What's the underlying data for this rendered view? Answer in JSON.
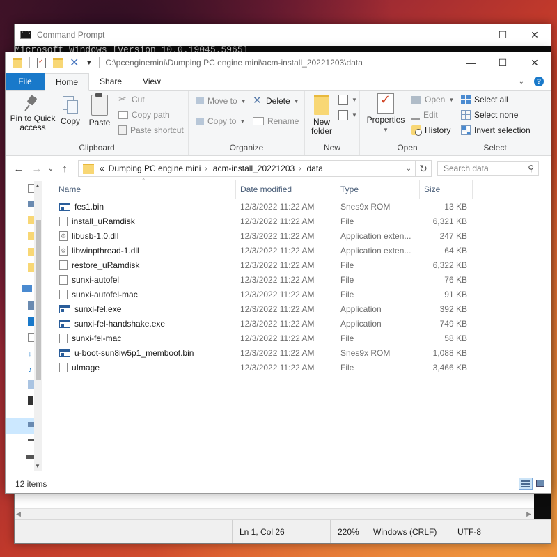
{
  "cmd": {
    "title": "Command Prompt",
    "body_text": "Microsoft Windows [Version 10.0.19045.5965]"
  },
  "notepad_status": {
    "position": "Ln 1, Col 26",
    "zoom": "220%",
    "line_ending": "Windows (CRLF)",
    "encoding": "UTF-8"
  },
  "explorer": {
    "title_path": "C:\\pcenginemini\\Dumping PC engine mini\\acm-install_20221203\\data",
    "window_controls": {
      "minimize": "—",
      "maximize": "☐",
      "close": "✕"
    },
    "tabs": {
      "file": "File",
      "home": "Home",
      "share": "Share",
      "view": "View"
    },
    "ribbon": {
      "clipboard": {
        "label": "Clipboard",
        "pin": "Pin to Quick access",
        "copy": "Copy",
        "paste": "Paste",
        "cut": "Cut",
        "copy_path": "Copy path",
        "paste_shortcut": "Paste shortcut"
      },
      "organize": {
        "label": "Organize",
        "move_to": "Move to",
        "copy_to": "Copy to",
        "delete": "Delete",
        "rename": "Rename"
      },
      "new": {
        "label": "New",
        "new_folder": "New folder"
      },
      "open": {
        "label": "Open",
        "properties": "Properties",
        "open": "Open",
        "edit": "Edit",
        "history": "History"
      },
      "select": {
        "label": "Select",
        "select_all": "Select all",
        "select_none": "Select none",
        "invert": "Invert selection"
      }
    },
    "address": {
      "prefix": "«",
      "crumbs": [
        "Dumping PC engine mini",
        "acm-install_20221203",
        "data"
      ]
    },
    "search": {
      "placeholder": "Search data"
    },
    "columns": {
      "name": "Name",
      "date": "Date modified",
      "type": "Type",
      "size": "Size"
    },
    "files": [
      {
        "name": "fes1.bin",
        "date": "12/3/2022 11:22 AM",
        "type": "Snes9x ROM",
        "size": "13 KB",
        "icon": "rom"
      },
      {
        "name": "install_uRamdisk",
        "date": "12/3/2022 11:22 AM",
        "type": "File",
        "size": "6,321 KB",
        "icon": "file"
      },
      {
        "name": "libusb-1.0.dll",
        "date": "12/3/2022 11:22 AM",
        "type": "Application exten...",
        "size": "247 KB",
        "icon": "dll"
      },
      {
        "name": "libwinpthread-1.dll",
        "date": "12/3/2022 11:22 AM",
        "type": "Application exten...",
        "size": "64 KB",
        "icon": "dll"
      },
      {
        "name": "restore_uRamdisk",
        "date": "12/3/2022 11:22 AM",
        "type": "File",
        "size": "6,322 KB",
        "icon": "file"
      },
      {
        "name": "sunxi-autofel",
        "date": "12/3/2022 11:22 AM",
        "type": "File",
        "size": "76 KB",
        "icon": "file"
      },
      {
        "name": "sunxi-autofel-mac",
        "date": "12/3/2022 11:22 AM",
        "type": "File",
        "size": "91 KB",
        "icon": "file"
      },
      {
        "name": "sunxi-fel.exe",
        "date": "12/3/2022 11:22 AM",
        "type": "Application",
        "size": "392 KB",
        "icon": "exe"
      },
      {
        "name": "sunxi-fel-handshake.exe",
        "date": "12/3/2022 11:22 AM",
        "type": "Application",
        "size": "749 KB",
        "icon": "exe"
      },
      {
        "name": "sunxi-fel-mac",
        "date": "12/3/2022 11:22 AM",
        "type": "File",
        "size": "58 KB",
        "icon": "file"
      },
      {
        "name": "u-boot-sun8iw5p1_memboot.bin",
        "date": "12/3/2022 11:22 AM",
        "type": "Snes9x ROM",
        "size": "1,088 KB",
        "icon": "rom"
      },
      {
        "name": "uImage",
        "date": "12/3/2022 11:22 AM",
        "type": "File",
        "size": "3,466 KB",
        "icon": "file"
      }
    ],
    "status": {
      "count": "12 items"
    }
  }
}
